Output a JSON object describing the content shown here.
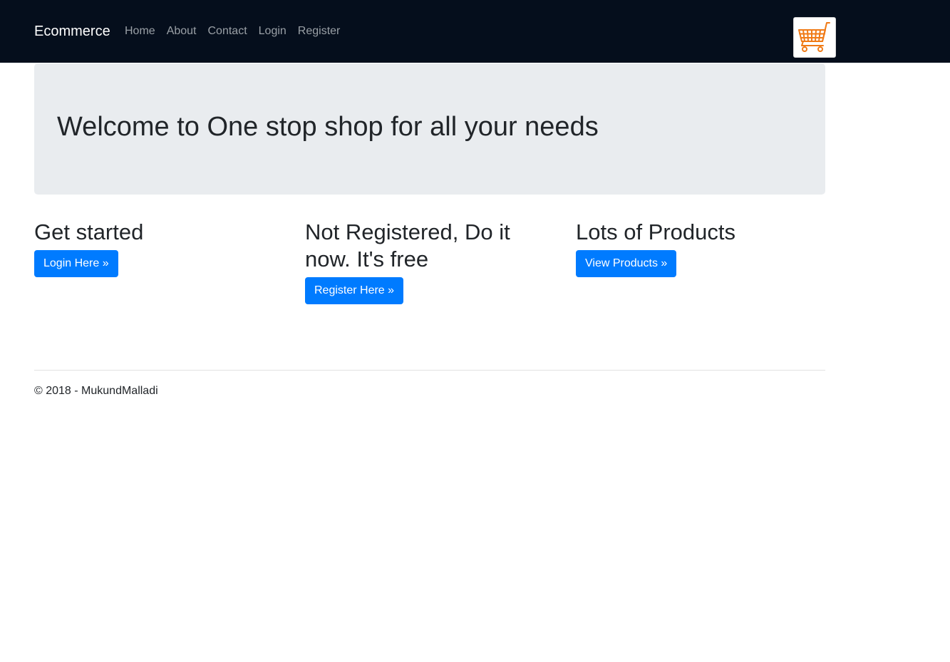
{
  "navbar": {
    "brand": "Ecommerce",
    "links": [
      "Home",
      "About",
      "Contact",
      "Login",
      "Register"
    ],
    "cart_icon": "shopping-cart-icon",
    "cart_color": "#f07a16",
    "background": "#050e1c"
  },
  "jumbotron": {
    "heading": "Welcome to One stop shop for all your needs"
  },
  "columns": [
    {
      "heading": "Get started",
      "button": "Login Here »"
    },
    {
      "heading": "Not Registered, Do it now. It's free",
      "button": "Register Here »"
    },
    {
      "heading": "Lots of Products",
      "button": "View Products »"
    }
  ],
  "colors": {
    "primary": "#007bff",
    "jumbotron_bg": "#e9ecef"
  },
  "footer": {
    "text": "© 2018 - MukundMalladi"
  }
}
